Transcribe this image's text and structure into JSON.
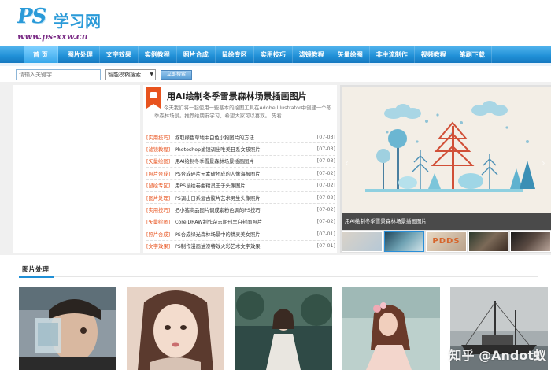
{
  "header": {
    "logo_mark": "PS",
    "logo_text": "学习网",
    "logo_url": "www.ps-xxw.cn"
  },
  "nav": {
    "items": [
      {
        "label": "首  页",
        "active": true
      },
      {
        "label": "图片处理"
      },
      {
        "label": "文字效果"
      },
      {
        "label": "实例教程"
      },
      {
        "label": "照片合成"
      },
      {
        "label": "鼠绘专区"
      },
      {
        "label": "实用技巧"
      },
      {
        "label": "滤镜教程"
      },
      {
        "label": "矢量绘图"
      },
      {
        "label": "非主流制作"
      },
      {
        "label": "视频教程"
      },
      {
        "label": "笔刷下载"
      }
    ]
  },
  "search": {
    "placeholder": "请输入关键字",
    "mode": "智能模糊搜索",
    "button": "立即搜索"
  },
  "feature": {
    "title": "用AI绘制冬季雪景森林场景插画图片",
    "desc": "今天我们将一起使用一些基本的绘图工具在Adobe Illustrator中创建一个冬季森林场景。推荐给朋友学习，希望大家可以喜欢。 先看..."
  },
  "news": [
    {
      "cat": "[实用技巧]",
      "title": "抠取绿色草地中白色小狗图片的方法",
      "date": "[07-03]"
    },
    {
      "cat": "[滤镜教程]",
      "title": "Photoshop滤镜调出唯美日系女孩照片",
      "date": "[07-03]"
    },
    {
      "cat": "[矢量绘图]",
      "title": "用AI绘制冬季雪景森林场景插画图片",
      "date": "[07-03]"
    },
    {
      "cat": "[照片合成]",
      "title": "PS合成碎片元素破坏成的人像海报图片",
      "date": "[07-02]"
    },
    {
      "cat": "[鼠绘专区]",
      "title": "用PS鼠绘卷曲精灵王子头像图片",
      "date": "[07-02]"
    },
    {
      "cat": "[图片处理]",
      "title": "PS调出日系复古胶片艺术男生头像照片",
      "date": "[07-02]"
    },
    {
      "cat": "[实用技巧]",
      "title": "把小猪商品图片调成素粉色调的PS技巧",
      "date": "[07-02]"
    },
    {
      "cat": "[矢量绘图]",
      "title": "CorelDRAW制作杂志期刊黑白封面照片",
      "date": "[07-02]"
    },
    {
      "cat": "[照片合成]",
      "title": "PS合成绿光森林场景中的精灵美女照片",
      "date": "[07-01]"
    },
    {
      "cat": "[文字效果]",
      "title": "PS制作漫画油漆特效火彩艺术文字效果",
      "date": "[07-01]"
    }
  ],
  "carousel": {
    "caption": "用AI绘制冬季雪景森林场景插画图片",
    "thumb3_text": "PDDS"
  },
  "section": {
    "title": "图片处理"
  },
  "watermark": "知乎 @Andot蚁"
}
